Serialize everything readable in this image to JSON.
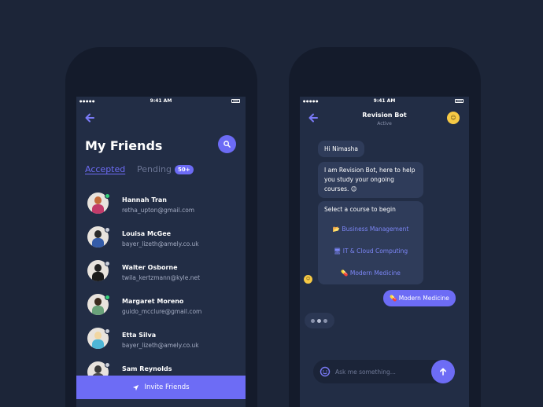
{
  "status": {
    "time": "9:41 AM",
    "signal": "●●●●●"
  },
  "friends_screen": {
    "title": "My Friends",
    "tabs": {
      "accepted": "Accepted",
      "pending": "Pending",
      "pending_count": "50+"
    },
    "friends": [
      {
        "name": "Hannah Tran",
        "email": "retha_upton@gmail.com",
        "online": true,
        "hair": "#c46a3a",
        "shirt": "#c23b6a"
      },
      {
        "name": "Louisa McGee",
        "email": "bayer_lizeth@amely.co.uk",
        "online": false,
        "hair": "#2a2a2a",
        "shirt": "#355ca8"
      },
      {
        "name": "Walter Osborne",
        "email": "twila_kertzmann@kyle.net",
        "online": false,
        "hair": "#222222",
        "shirt": "#1a1a1a"
      },
      {
        "name": "Margaret Moreno",
        "email": "guido_mcclure@gmail.com",
        "online": true,
        "hair": "#3a2a1e",
        "shirt": "#6aa27a"
      },
      {
        "name": "Etta Silva",
        "email": "bayer_lizeth@amely.co.uk",
        "online": false,
        "hair": "#f1d6a1",
        "shirt": "#4fb6d6"
      },
      {
        "name": "Sam Reynolds",
        "email": "",
        "online": false,
        "hair": "#3a3a3a",
        "shirt": "#4a4a4a"
      }
    ],
    "invite_label": "Invite Friends",
    "colors": {
      "accent": "#6d6cf5",
      "online": "#36d07a",
      "offline": "#c9cdd8"
    }
  },
  "bot_screen": {
    "title": "Revision Bot",
    "status": "Active",
    "messages": {
      "greeting": "Hi Nimasha",
      "intro": "I am Revision Bot, here to help you study your ongoing courses. 😊",
      "prompt": "Select a course to begin"
    },
    "courses": [
      {
        "icon": "📂",
        "label": "Business Management"
      },
      {
        "icon": "🖥",
        "label": "IT & Cloud Computing"
      },
      {
        "icon": "💊",
        "label": "Modern Medicine"
      }
    ],
    "user_reply": {
      "icon": "💊",
      "label": "Modern Medicine"
    },
    "input_placeholder": "Ask me something..."
  }
}
